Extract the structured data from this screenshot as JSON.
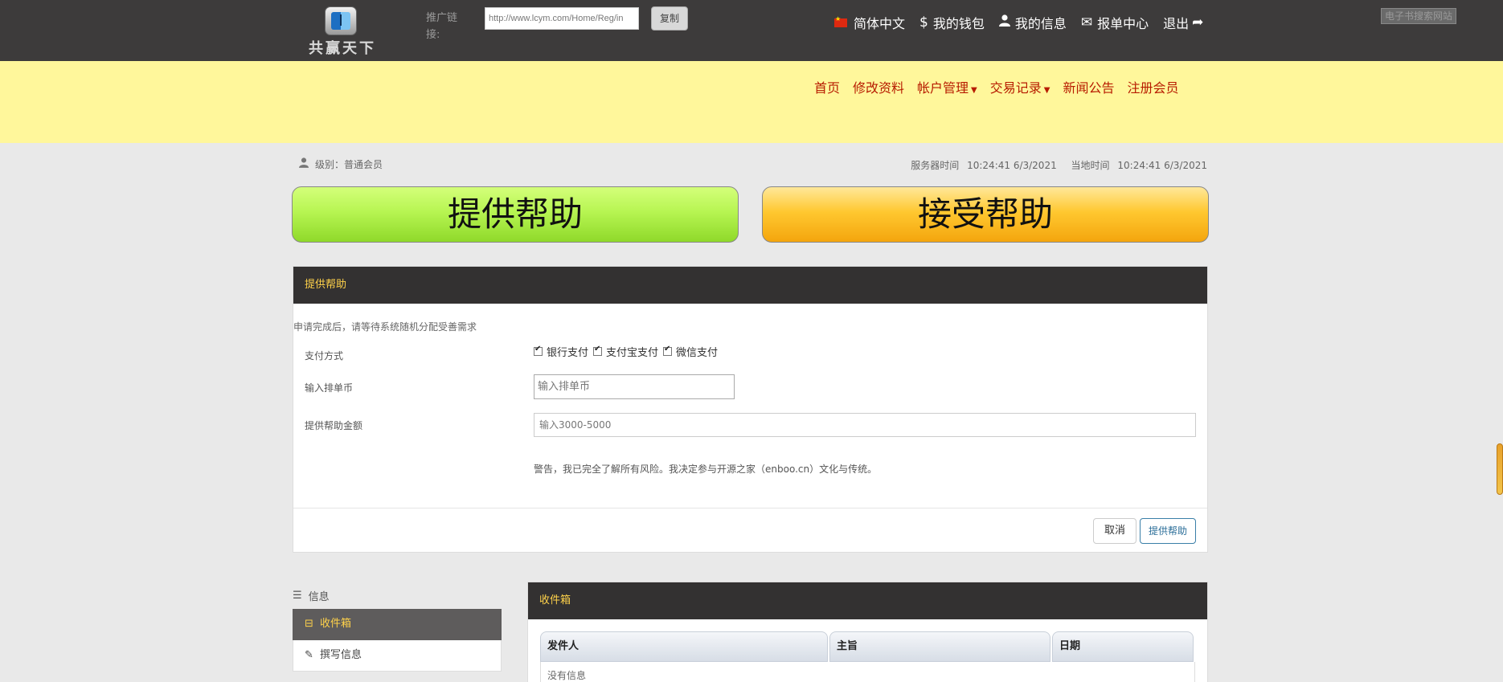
{
  "header": {
    "logo_text": "共赢天下",
    "promo_label": "推广链接:",
    "promo_url": "http://www.lcym.com/Home/Reg/in",
    "copy_label": "复制",
    "nav": [
      {
        "label": "简体中文",
        "icon": "flag-cn-icon"
      },
      {
        "label": "我的钱包",
        "icon": "dollar-icon"
      },
      {
        "label": "我的信息",
        "icon": "user-icon"
      },
      {
        "label": "报单中心",
        "icon": "envelope-icon"
      },
      {
        "label": "退出",
        "icon": "share-arrow-icon"
      }
    ],
    "search_label": "电子书搜索网站"
  },
  "main_nav": [
    {
      "label": "首页"
    },
    {
      "label": "修改资料"
    },
    {
      "label": "帐户管理",
      "dropdown": true
    },
    {
      "label": "交易记录",
      "dropdown": true
    },
    {
      "label": "新闻公告"
    },
    {
      "label": "注册会员"
    }
  ],
  "status": {
    "level": "级别：普通会员",
    "server_time_label": "服务器时间",
    "server_time": "10:24:41 6/3/2021",
    "local_time_label": "当地时间",
    "local_time": "10:24:41 6/3/2021"
  },
  "big_buttons": {
    "provide": "提供帮助",
    "receive": "接受帮助"
  },
  "provide_panel": {
    "title": "提供帮助",
    "note": "申请完成后，请等待系统随机分配受善需求",
    "pay_label": "支付方式",
    "pay_methods": [
      {
        "label": "银行支付",
        "checked": true
      },
      {
        "label": "支付宝支付",
        "checked": true
      },
      {
        "label": "微信支付",
        "checked": true
      }
    ],
    "coin_label": "输入排单币",
    "coin_placeholder": "输入排单币",
    "amount_label": "提供帮助金额",
    "amount_placeholder": "输入3000-5000",
    "warning": "警告，我已完全了解所有风险。我决定参与开源之家（enboo.cn）文化与传统。",
    "cancel": "取消",
    "submit": "提供帮助"
  },
  "sidebar": {
    "title": "信息",
    "items": [
      {
        "label": "收件箱",
        "icon": "inbox-icon",
        "active": true
      },
      {
        "label": "撰写信息",
        "icon": "edit-icon",
        "active": false
      }
    ]
  },
  "inbox": {
    "title": "收件箱",
    "columns": [
      "发件人",
      "主旨",
      "日期"
    ],
    "empty": "没有信息"
  }
}
